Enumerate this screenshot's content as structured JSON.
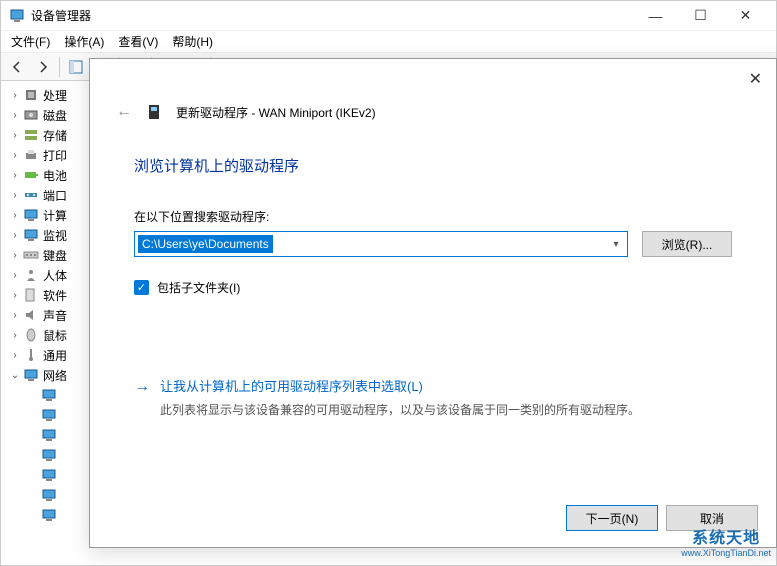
{
  "window": {
    "title": "设备管理器",
    "controls": {
      "min": "—",
      "max": "☐",
      "close": "✕"
    }
  },
  "menu": {
    "file": "文件(F)",
    "action": "操作(A)",
    "view": "查看(V)",
    "help": "帮助(H)"
  },
  "tree": {
    "items": [
      {
        "label": "处理",
        "icon": "cpu"
      },
      {
        "label": "磁盘",
        "icon": "disk"
      },
      {
        "label": "存储",
        "icon": "storage"
      },
      {
        "label": "打印",
        "icon": "printer"
      },
      {
        "label": "电池",
        "icon": "battery"
      },
      {
        "label": "端口",
        "icon": "port"
      },
      {
        "label": "计算",
        "icon": "computer"
      },
      {
        "label": "监视",
        "icon": "monitor"
      },
      {
        "label": "键盘",
        "icon": "keyboard"
      },
      {
        "label": "人体",
        "icon": "hid"
      },
      {
        "label": "软件",
        "icon": "software"
      },
      {
        "label": "声音",
        "icon": "audio"
      },
      {
        "label": "鼠标",
        "icon": "mouse"
      },
      {
        "label": "通用",
        "icon": "usb"
      }
    ],
    "expanded": {
      "label": "网络",
      "icon": "network",
      "childCount": 7
    }
  },
  "dialog": {
    "header": "更新驱动程序 - WAN Miniport (IKEv2)",
    "heading": "浏览计算机上的驱动程序",
    "path_label": "在以下位置搜索驱动程序:",
    "path_value": "C:\\Users\\ye\\Documents",
    "browse": "浏览(R)...",
    "include_sub": "包括子文件夹(I)",
    "pick_title": "让我从计算机上的可用驱动程序列表中选取(L)",
    "pick_desc": "此列表将显示与该设备兼容的可用驱动程序，以及与该设备属于同一类别的所有驱动程序。",
    "next": "下一页(N)",
    "cancel": "取消"
  },
  "watermark": {
    "line1": "系统天地",
    "line2": "www.XiTongTianDi.net"
  }
}
